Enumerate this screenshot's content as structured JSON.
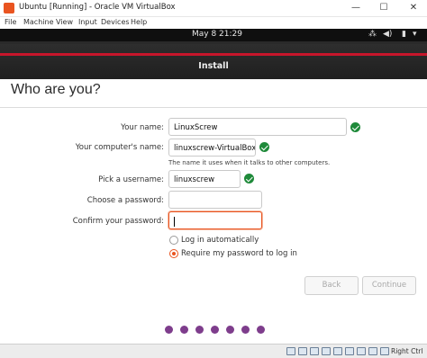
{
  "window": {
    "title": "Ubuntu [Running] - Oracle VM VirtualBox",
    "minimize_glyph": "—",
    "maximize_glyph": "☐",
    "close_glyph": "✕"
  },
  "menubar": [
    "File",
    "Machine",
    "View",
    "Input",
    "Devices",
    "Help"
  ],
  "topbar": {
    "clock": "May 8  21:29",
    "network_glyph": "⁂",
    "volume_glyph": "◀)",
    "power_glyph": "▮",
    "menu_glyph": "▾"
  },
  "installer": {
    "header_title": "Install",
    "page_title": "Who are you?"
  },
  "form": {
    "name_label": "Your name:",
    "name_value": "LinuxScrew",
    "computer_label": "Your computer's name:",
    "computer_value": "linuxscrew-VirtualBox",
    "computer_hint": "The name it uses when it talks to other computers.",
    "username_label": "Pick a username:",
    "username_value": "linuxscrew",
    "password_label": "Choose a password:",
    "password_value": "",
    "confirm_label": "Confirm your password:",
    "confirm_value": ""
  },
  "login_options": {
    "auto_label": "Log in automatically",
    "require_label": "Require my password to log in",
    "selected": "require"
  },
  "buttons": {
    "back": "Back",
    "continue": "Continue"
  },
  "progress": {
    "total_steps": 7
  },
  "statusbar": {
    "host_key": "Right Ctrl"
  },
  "colors": {
    "accent": "#e95420",
    "valid": "#1f8a3a",
    "progress_dot": "#7e3d8c",
    "header_stripe": "#c7162b"
  }
}
